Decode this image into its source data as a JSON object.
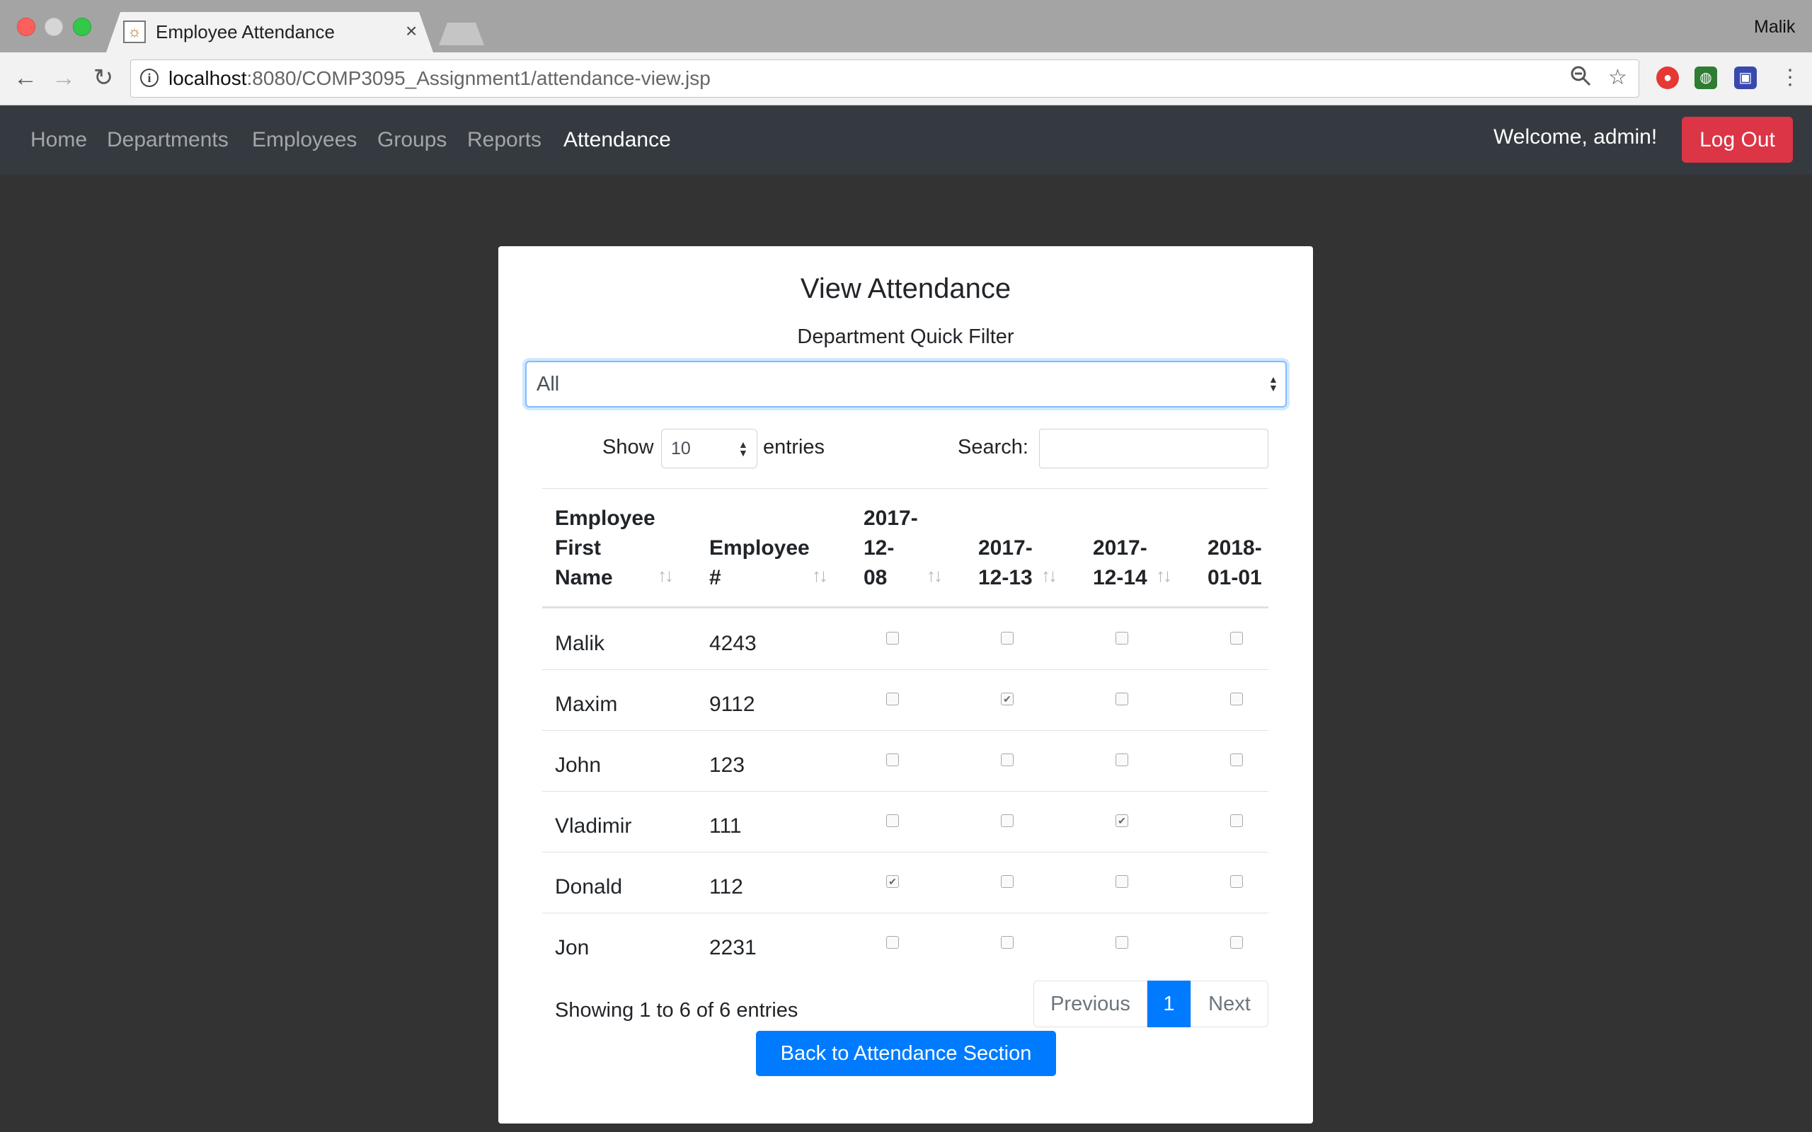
{
  "browser": {
    "tab_title": "Employee Attendance",
    "close_glyph": "×",
    "profile_name": "Malik",
    "url_host": "localhost",
    "url_rest": ":8080/COMP3095_Assignment1/attendance-view.jsp",
    "icons": [
      "back-icon",
      "forward-icon",
      "reload-icon",
      "info-icon",
      "zoom-icon",
      "bookmark-star-icon",
      "menu-icon"
    ]
  },
  "navbar": {
    "links": [
      "Home",
      "Departments",
      "Employees",
      "Groups",
      "Reports",
      "Attendance"
    ],
    "active": "Attendance",
    "welcome": "Welcome, admin!",
    "logout_label": "Log Out"
  },
  "card": {
    "title": "View Attendance",
    "filter_label": "Department Quick Filter",
    "filter_value": "All"
  },
  "table_controls": {
    "show_label": "Show",
    "show_value": "10",
    "entries_label": "entries",
    "search_label": "Search:"
  },
  "table": {
    "headers": [
      [
        "Employee",
        "First",
        "Name"
      ],
      [
        "Employee",
        "#"
      ],
      [
        "2017-",
        "12-",
        "08"
      ],
      [
        "2017-",
        "12-13"
      ],
      [
        "2017-",
        "12-14"
      ],
      [
        "2018-",
        "01-01"
      ]
    ],
    "rows": [
      {
        "name": "Malik",
        "number": "4243",
        "attendance": [
          false,
          false,
          false,
          false
        ]
      },
      {
        "name": "Maxim",
        "number": "9112",
        "attendance": [
          false,
          true,
          false,
          false
        ]
      },
      {
        "name": "John",
        "number": "123",
        "attendance": [
          false,
          false,
          false,
          false
        ]
      },
      {
        "name": "Vladimir",
        "number": "111",
        "attendance": [
          false,
          false,
          true,
          false
        ]
      },
      {
        "name": "Donald",
        "number": "112",
        "attendance": [
          true,
          false,
          false,
          false
        ]
      },
      {
        "name": "Jon",
        "number": "2231",
        "attendance": [
          false,
          false,
          false,
          false
        ]
      }
    ]
  },
  "pagination": {
    "info": "Showing 1 to 6 of 6 entries",
    "previous": "Previous",
    "current": "1",
    "next": "Next"
  },
  "back_button": "Back to Attendance Section",
  "colors": {
    "navbar_bg": "#343a40",
    "page_bg": "#333333",
    "primary": "#007bff",
    "danger": "#dc3545"
  }
}
